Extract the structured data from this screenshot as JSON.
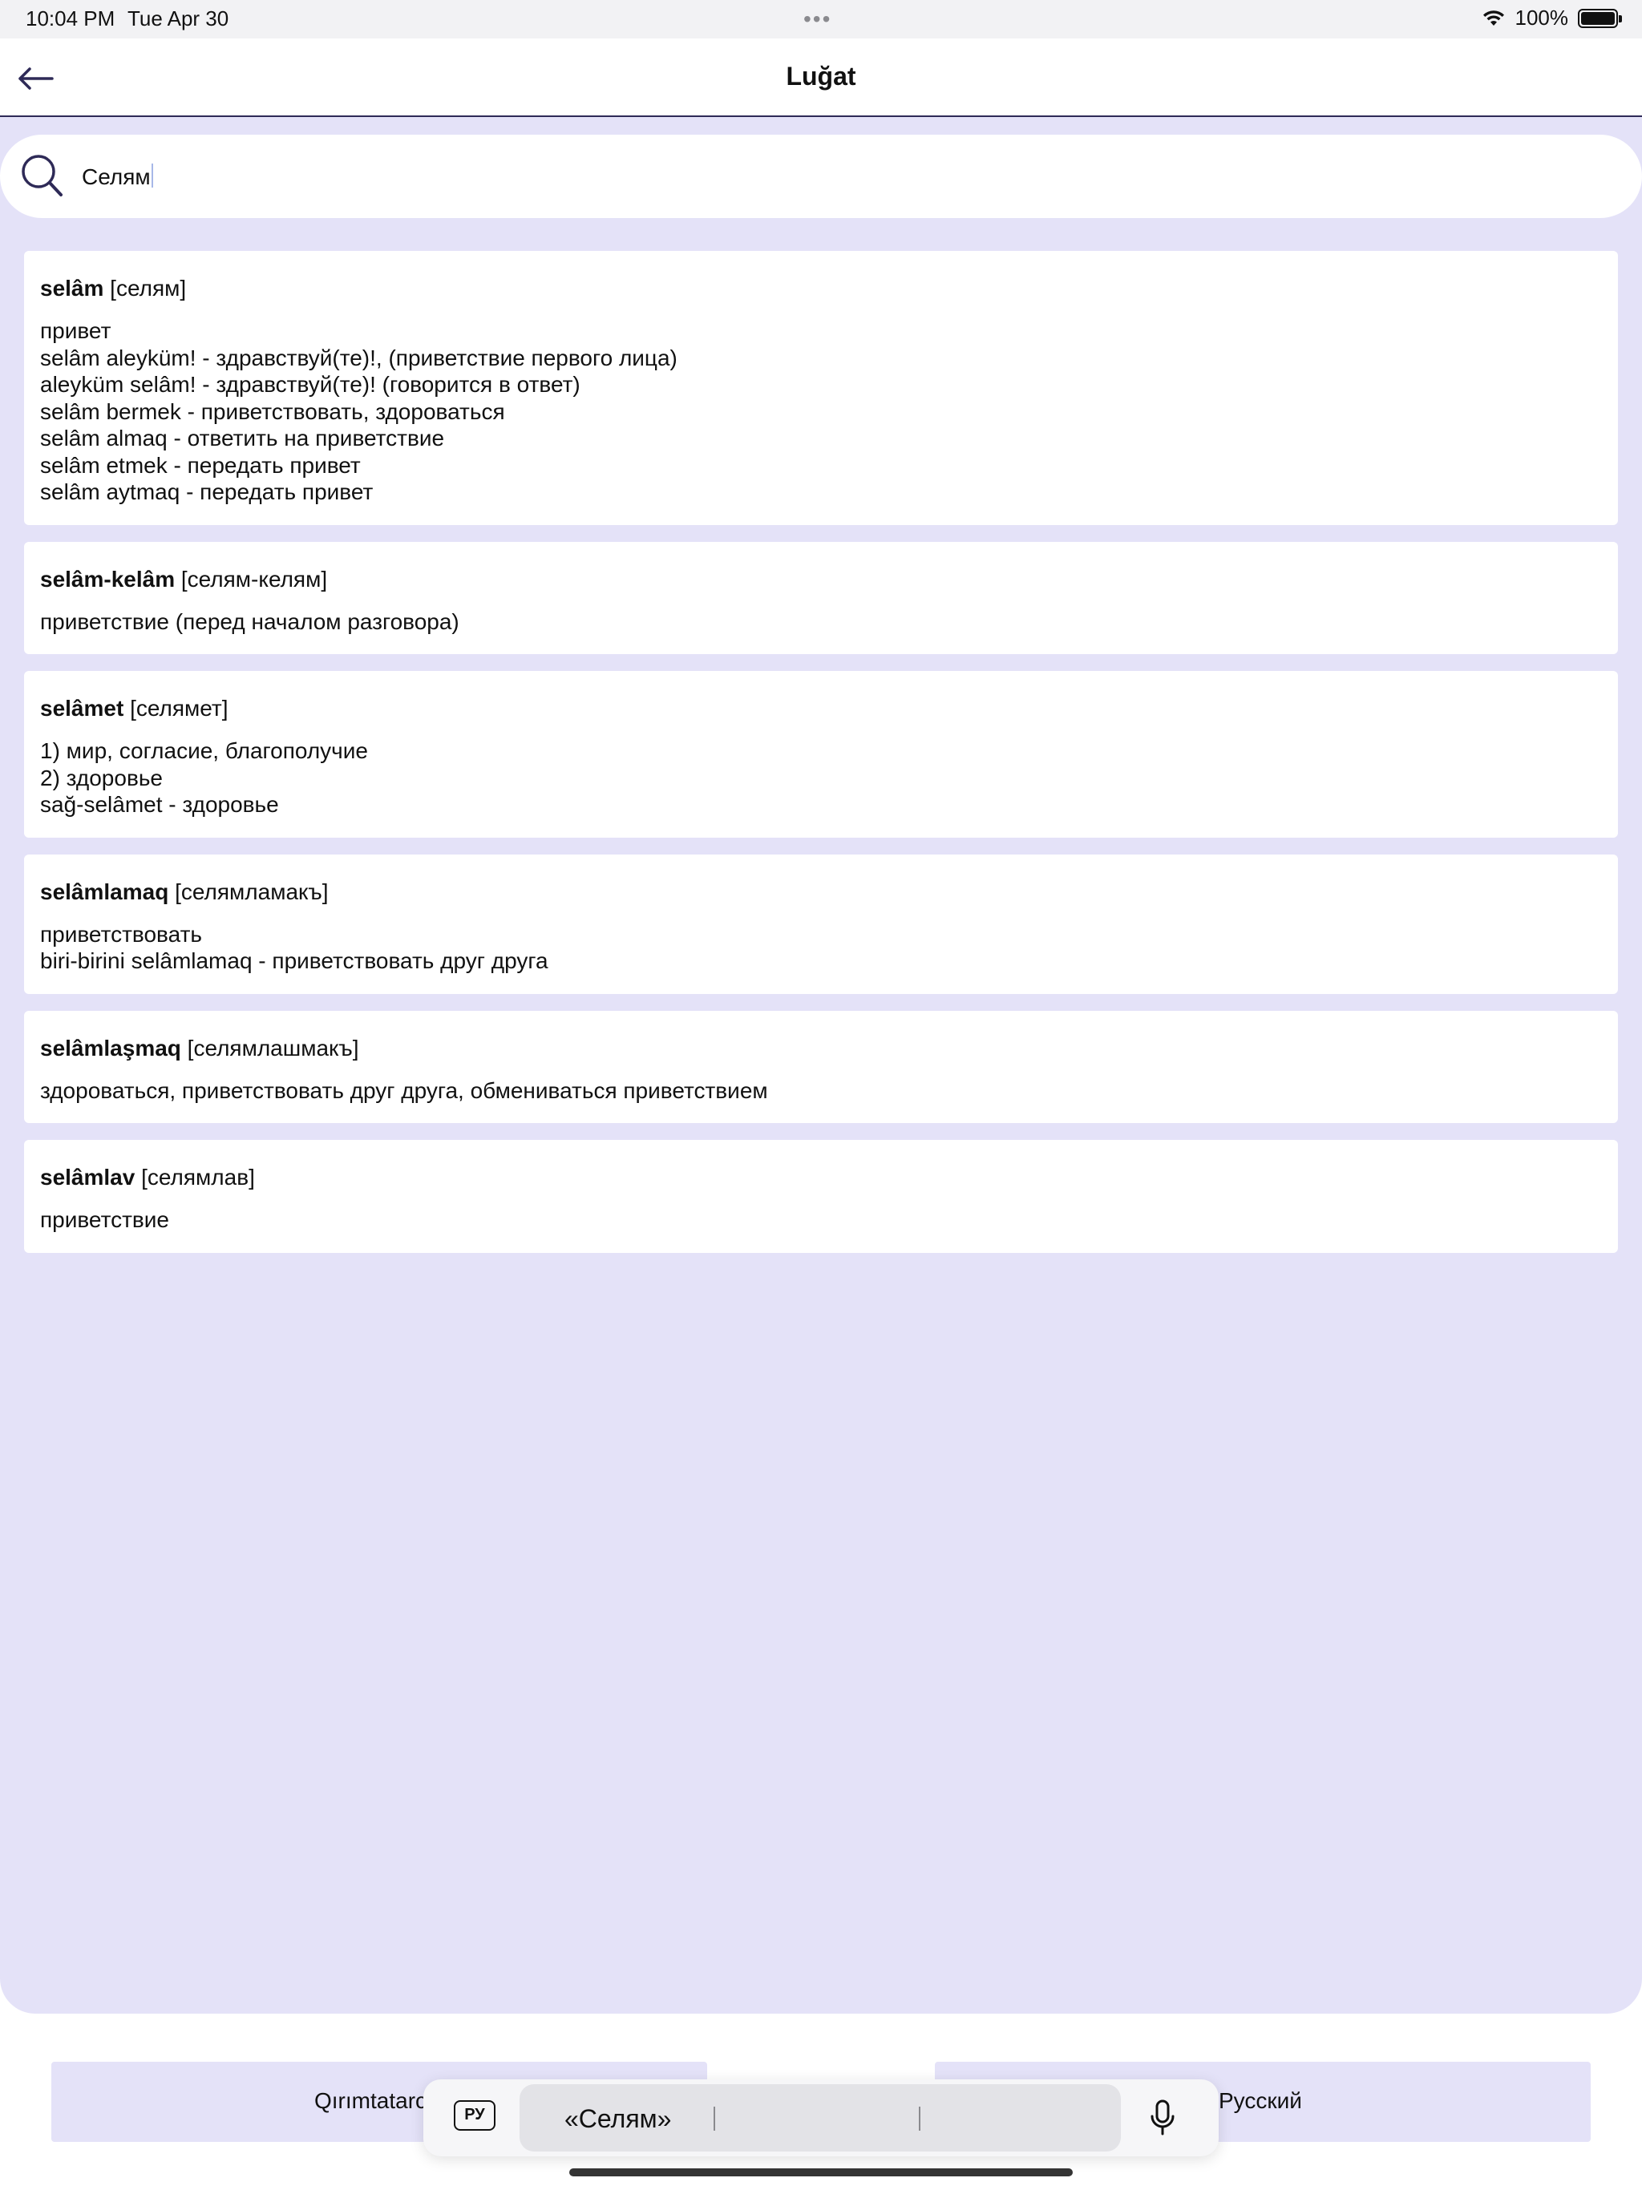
{
  "status_bar": {
    "time": "10:04 PM",
    "date": "Tue Apr 30",
    "battery": "100%",
    "wifi_icon": "wifi-icon",
    "battery_icon": "battery-full-icon"
  },
  "nav": {
    "title": "Luğat",
    "back_icon": "arrow-left-icon"
  },
  "search": {
    "icon": "search-icon",
    "value": "Селям"
  },
  "entries": [
    {
      "word": "selâm",
      "translit": " [селям]",
      "lines": [
        "привет",
        "selâm aleyküm! - здравствуй(те)!, (приветствие первого лица)",
        "aleyküm selâm! - здравствуй(те)! (говорится в ответ)",
        "selâm bermek - приветствовать, здороваться",
        "selâm almaq - ответить на приветствие",
        "selâm etmek - передать привет",
        "selâm aytmaq - передать привет"
      ]
    },
    {
      "word": "selâm-kelâm",
      "translit": " [селям-келям]",
      "lines": [
        "приветствие (перед началом разговора)"
      ]
    },
    {
      "word": "selâmet",
      "translit": " [селямет]",
      "lines": [
        "1) мир, согласие, благополучие",
        "2) здоровье",
        "sağ-selâmet - здоровье"
      ]
    },
    {
      "word": "selâmlamaq",
      "translit": " [селямламакъ]",
      "lines": [
        "приветствовать",
        "biri-birini selâmlamaq - приветствовать друг друга"
      ]
    },
    {
      "word": "selâmlaşmaq",
      "translit": " [селямлашмакъ]",
      "lines": [
        "здороваться, приветствовать друг друга, обмениваться приветствием"
      ]
    },
    {
      "word": "selâmlav",
      "translit": " [селямлав]",
      "lines": [
        "приветствие"
      ]
    }
  ],
  "language_tabs": {
    "left": "Qırımtatarc",
    "right": "Русский"
  },
  "keyboard": {
    "language_key": "РУ",
    "suggestions": [
      "«Селям»",
      "",
      ""
    ],
    "mic_icon": "microphone-icon"
  },
  "colors": {
    "panel_background": "#e4e2f8",
    "accent": "#2e2a57",
    "card_background": "#ffffff"
  }
}
